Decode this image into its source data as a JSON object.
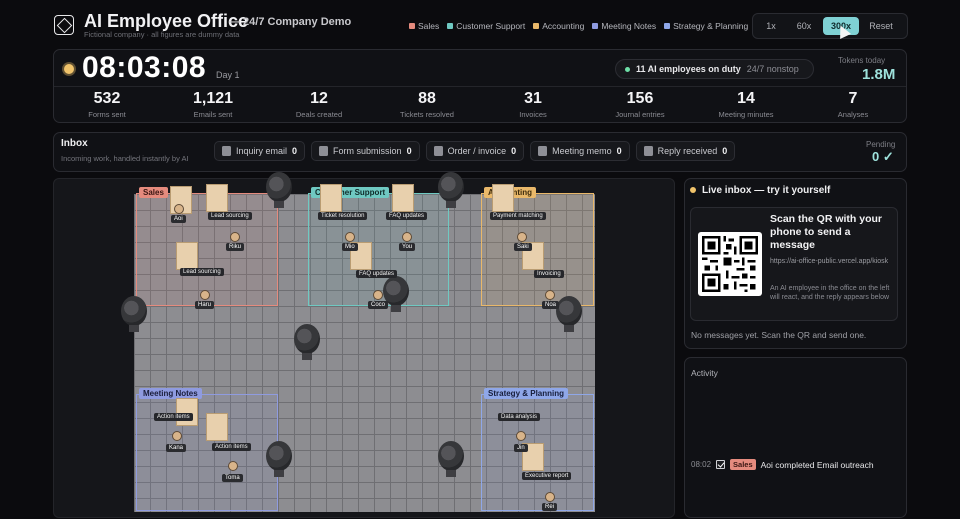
{
  "header": {
    "title": "AI Employee Office",
    "subtitle": "— 24/7 Company Demo",
    "note": "Fictional company · all figures are dummy data",
    "legend": [
      {
        "label": "Sales",
        "color": "#e58b7e"
      },
      {
        "label": "Customer Support",
        "color": "#6fc9c2"
      },
      {
        "label": "Accounting",
        "color": "#e9b86a"
      },
      {
        "label": "Meeting Notes",
        "color": "#8f9be0"
      },
      {
        "label": "Strategy & Planning",
        "color": "#8fa7e8"
      }
    ],
    "speed": {
      "x1": "1x",
      "x60": "60x",
      "x300": "300x",
      "reset": "Reset",
      "active": "300x"
    }
  },
  "status": {
    "clock": "08:03:08",
    "day": "Day 1",
    "duty": "11 AI employees on duty",
    "duty_mode": "24/7 nonstop",
    "tokens_label": "Tokens today",
    "tokens_value": "1.8M"
  },
  "stats": [
    {
      "value": "532",
      "label": "Forms sent"
    },
    {
      "value": "1,121",
      "label": "Emails sent"
    },
    {
      "value": "12",
      "label": "Deals created"
    },
    {
      "value": "88",
      "label": "Tickets resolved"
    },
    {
      "value": "31",
      "label": "Invoices"
    },
    {
      "value": "156",
      "label": "Journal entries"
    },
    {
      "value": "14",
      "label": "Meeting minutes"
    },
    {
      "value": "7",
      "label": "Analyses"
    }
  ],
  "inbox": {
    "title": "Inbox",
    "subtitle": "Incoming work, handled instantly by AI",
    "chips": [
      {
        "label": "Inquiry email",
        "count": "0"
      },
      {
        "label": "Form submission",
        "count": "0"
      },
      {
        "label": "Order / invoice",
        "count": "0"
      },
      {
        "label": "Meeting memo",
        "count": "0"
      },
      {
        "label": "Reply received",
        "count": "0"
      }
    ],
    "pending_label": "Pending",
    "pending_value": "0 ✓"
  },
  "office": {
    "zones": {
      "sales": "Sales",
      "support": "Customer Support",
      "accounting": "Accounting",
      "meeting": "Meeting Notes",
      "strategy": "Strategy & Planning"
    },
    "tasks": {
      "aoi": "Lead sourcing",
      "haru": "Lead sourcing",
      "mio": "Ticket resolution",
      "you": "FAQ updates",
      "coco": "FAQ updates",
      "saki": "Payment matching",
      "noa": "Invoicing",
      "kana": "Action items",
      "toma": "Action items",
      "jin": "Data analysis",
      "rei": "Executive report"
    },
    "names": {
      "aoi": "Aoi",
      "riku": "Riku",
      "haru": "Haru",
      "mio": "Mio",
      "you": "You",
      "coco": "Coco",
      "saki": "Saki",
      "noa": "Noa",
      "kana": "Kana",
      "toma": "Toma",
      "jin": "Jin",
      "rei": "Rei"
    }
  },
  "live_inbox": {
    "title": "Live inbox — try it yourself",
    "qr_title": "Scan the QR with your phone to send a message",
    "url": "https://ai-office-public.vercel.app/kiosk",
    "desc": "An AI employee in the office on the left will react, and the reply appears below",
    "empty": "No messages yet. Scan the QR and send one."
  },
  "activity": {
    "title": "Activity",
    "items": [
      {
        "time": "08:02",
        "dept": "Sales",
        "text": "Aoi completed Email outreach"
      }
    ]
  }
}
